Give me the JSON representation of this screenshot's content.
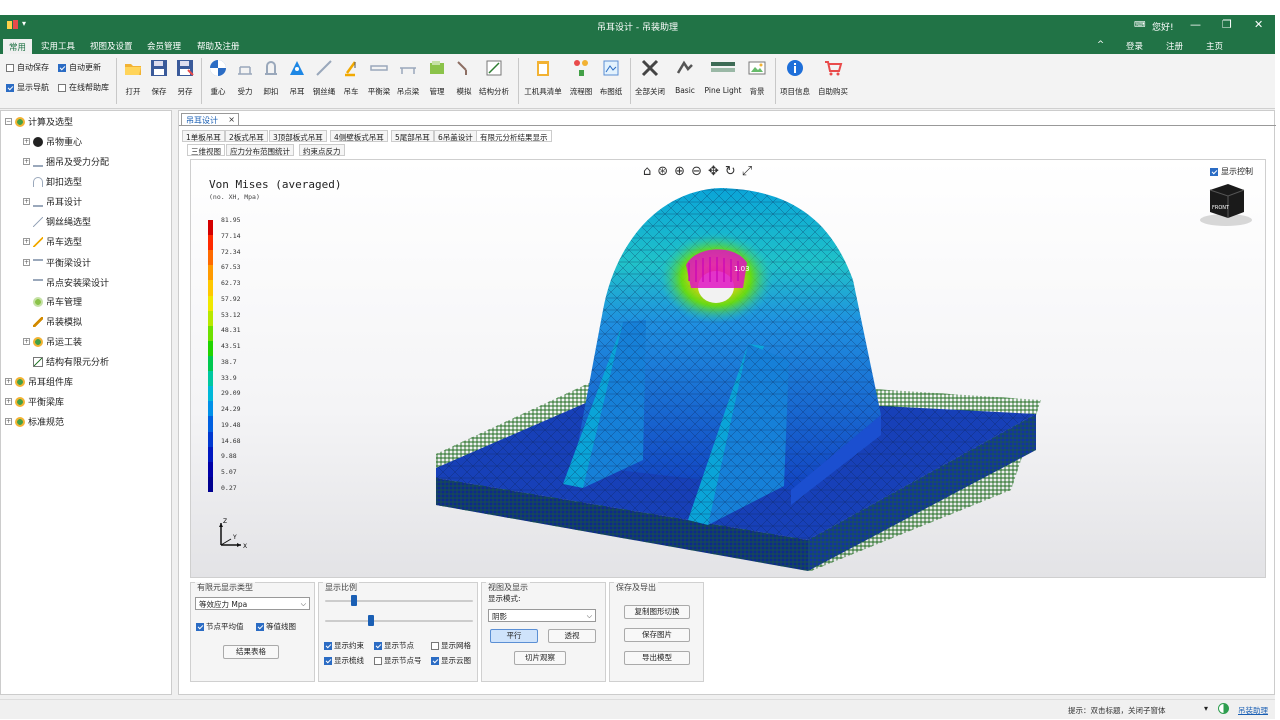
{
  "window": {
    "title": "吊耳设计 - 吊装助理",
    "user": "您好!"
  },
  "menu": {
    "items": [
      "常用",
      "实用工具",
      "视图及设置",
      "会员管理",
      "帮助及注册"
    ],
    "right": [
      "登录",
      "注册",
      "主页"
    ]
  },
  "ribbon": {
    "checks": [
      {
        "label": "自动保存",
        "checked": false
      },
      {
        "label": "自动更新",
        "checked": true
      },
      {
        "label": "显示导航",
        "checked": true
      },
      {
        "label": "在线帮助库",
        "checked": false
      }
    ],
    "buttons": [
      "打开",
      "保存",
      "另存",
      "重心",
      "受力",
      "卸扣",
      "吊耳",
      "钢丝绳",
      "吊车",
      "平衡梁",
      "吊点梁",
      "管理",
      "模拟",
      "结构分析",
      "工机具清单",
      "流程图",
      "布图纸",
      "全部关闭",
      "Basic",
      "Pine Light",
      "背景",
      "项目信息",
      "自助购买"
    ]
  },
  "tree": {
    "root": "计算及选型",
    "children": [
      "吊物重心",
      "捆吊及受力分配",
      "卸扣选型",
      "吊耳设计",
      "钢丝绳选型",
      "吊车选型",
      "平衡梁设计",
      "吊点安装梁设计",
      "吊车管理",
      "吊装模拟",
      "吊运工装",
      "结构有限元分析"
    ],
    "others": [
      "吊耳组件库",
      "平衡梁库",
      "标准规范"
    ]
  },
  "doc_tab": "吊耳设计",
  "sub_tabs": [
    "1单板吊耳",
    "2板式吊耳",
    "3顶部板式吊耳",
    "4侧壁板式吊耳",
    "5尾部吊耳",
    "6吊盖设计",
    "有限元分析结果显示"
  ],
  "view_tabs": [
    "三维视图",
    "应力分布范围统计",
    "约束点反力"
  ],
  "viewport": {
    "result_title": "Von Mises (averaged)",
    "result_subtitle": "(no. XH, Mpa)",
    "legend_values": [
      "81.95",
      "77.14",
      "72.34",
      "67.53",
      "62.73",
      "57.92",
      "53.12",
      "48.31",
      "43.51",
      "38.7",
      "33.9",
      "29.09",
      "24.29",
      "19.48",
      "14.68",
      "9.88",
      "5.07",
      "0.27"
    ],
    "legend_colors": [
      "#d40000",
      "#ff2a00",
      "#ff6a00",
      "#ff9a00",
      "#ffc800",
      "#f0e800",
      "#b8e800",
      "#6ee000",
      "#22d400",
      "#00c850",
      "#00c8a0",
      "#00b8d8",
      "#0090e8",
      "#0060e0",
      "#0038d0",
      "#0018c0",
      "#0000a8",
      "#000090"
    ],
    "peak_label": "1.03",
    "show_control": "显示控制",
    "view_cube": "FRONT",
    "axis": {
      "z": "Z",
      "y": "Y",
      "x": "X"
    }
  },
  "bottom": {
    "group1": {
      "title": "有限元显示类型",
      "select": "等效应力 Mpa",
      "checks": [
        {
          "label": "节点平均值",
          "checked": true
        },
        {
          "label": "等值线图",
          "checked": true
        }
      ],
      "button": "结果表格"
    },
    "group2": {
      "title": "显示比例",
      "slider1": 0.18,
      "slider2": 0.3,
      "checks": [
        {
          "label": "显示约束",
          "checked": true
        },
        {
          "label": "显示节点",
          "checked": true
        },
        {
          "label": "显示网格",
          "checked": false
        },
        {
          "label": "显示梳线",
          "checked": true
        },
        {
          "label": "显示节点号",
          "checked": false
        },
        {
          "label": "显示云图",
          "checked": true
        }
      ]
    },
    "group3": {
      "title": "视图及显示",
      "mode_label": "显示模式:",
      "mode_value": "阴影",
      "btn_parallel": "平行",
      "btn_persp": "透视",
      "btn_section": "切片观察"
    },
    "group4": {
      "title": "保存及导出",
      "btn_copy": "复制图形切换",
      "btn_save": "保存图片",
      "btn_export": "导出模型"
    }
  },
  "status": {
    "hint": "提示：双击标题，关闭子窗体",
    "link": "吊装助理"
  }
}
